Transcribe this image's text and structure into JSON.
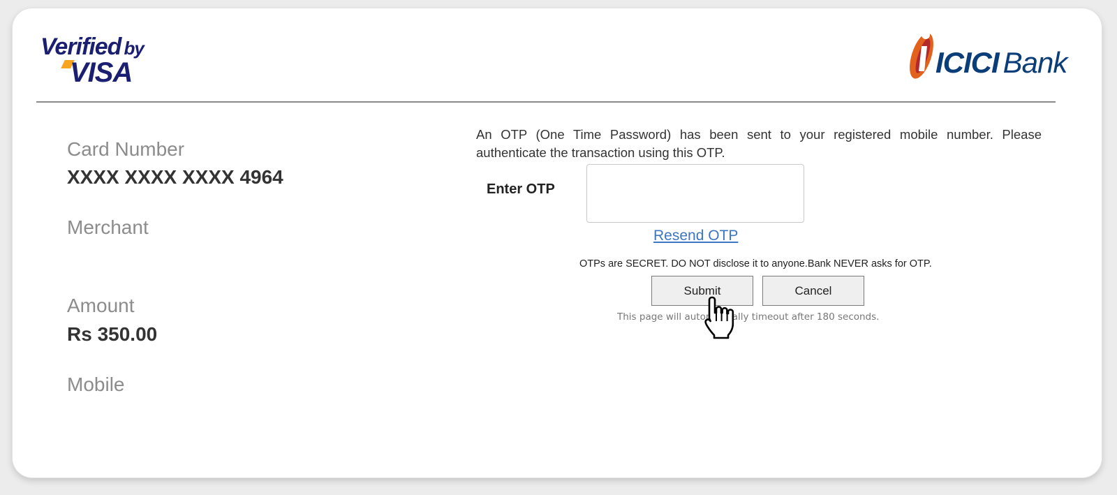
{
  "header": {
    "visa_logo": {
      "verified": "Verified",
      "by": "by",
      "brand": "VISA"
    },
    "bank_logo": {
      "name": "ICICI",
      "suffix": "Bank"
    }
  },
  "card_details": {
    "card_number_label": "Card Number",
    "card_number_value": "XXXX XXXX XXXX 4964",
    "merchant_label": "Merchant",
    "merchant_value": "",
    "amount_label": "Amount",
    "amount_value": "Rs 350.00",
    "mobile_label": "Mobile",
    "mobile_value": ""
  },
  "otp": {
    "message": "An OTP (One Time Password) has been sent to your registered mobile number. Please authenticate the transaction using this OTP.",
    "field_label": "Enter OTP",
    "field_value": "",
    "resend_label": "Resend OTP",
    "warning": "OTPs are SECRET. DO NOT disclose it to anyone.Bank NEVER asks for OTP.",
    "submit_label": "Submit",
    "cancel_label": "Cancel",
    "timeout_text": "This page will automatically timeout after 180 seconds."
  },
  "icons": {
    "cursor": "hand-pointer-icon",
    "bank_mark": "icici-i-icon"
  },
  "colors": {
    "visa_blue": "#1a1f71",
    "visa_gold": "#f7a520",
    "icici_blue": "#0b3d78",
    "icici_orange": "#e2611c",
    "icici_red": "#b3282d",
    "link_blue": "#3c76c2"
  }
}
